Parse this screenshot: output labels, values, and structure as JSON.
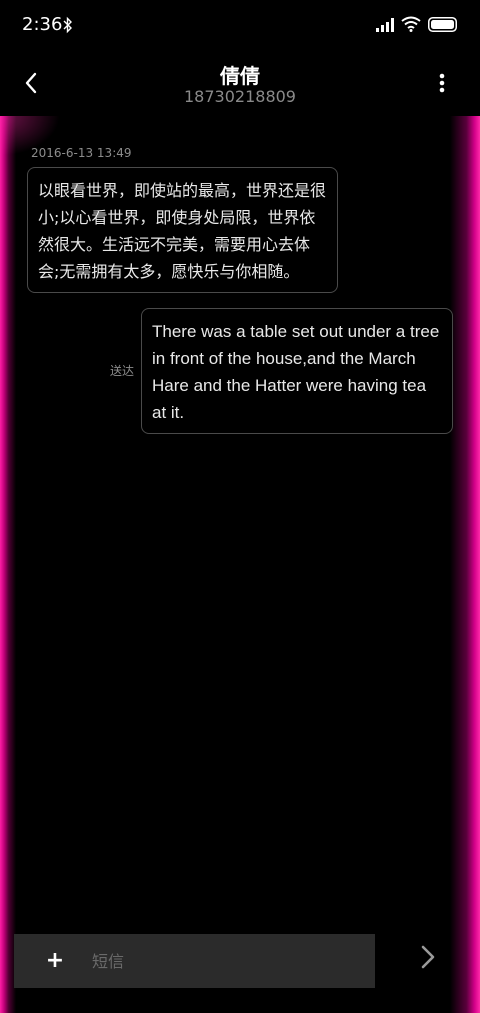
{
  "status_bar": {
    "time": "2:36",
    "icons": [
      "bluetooth-icon",
      "signal-icon",
      "wifi-icon",
      "battery-icon"
    ]
  },
  "header": {
    "contact_name": "倩倩",
    "contact_number": "18730218809",
    "back_icon": "chevron-left-icon",
    "more_icon": "more-vertical-icon"
  },
  "conversation": {
    "timestamp": "2016-6-13 13:49",
    "messages": [
      {
        "direction": "incoming",
        "lines": [
          "以眼看世界，即使站的最高，世界还是很",
          "小;以心看世界，即使身处局限，世界依",
          "然很大。生活远不完美，需要用心去体",
          "会;无需拥有太多，愿快乐与你相随。"
        ]
      },
      {
        "direction": "outgoing",
        "status": "送达",
        "lines": [
          "There was a table set out under a tree",
          "in front of the house,and the March",
          "Hare and the Hatter were having tea",
          "at it."
        ]
      }
    ]
  },
  "composer": {
    "attach_label": "+",
    "placeholder": "短信",
    "value": "",
    "send_icon": "chevron-right-icon"
  },
  "colors": {
    "background": "#000000",
    "glow": "#ff1fa6",
    "bubble_border": "#4a4a4a",
    "input_bg": "#2b2b2b",
    "secondary_text": "#8c8c8c"
  }
}
